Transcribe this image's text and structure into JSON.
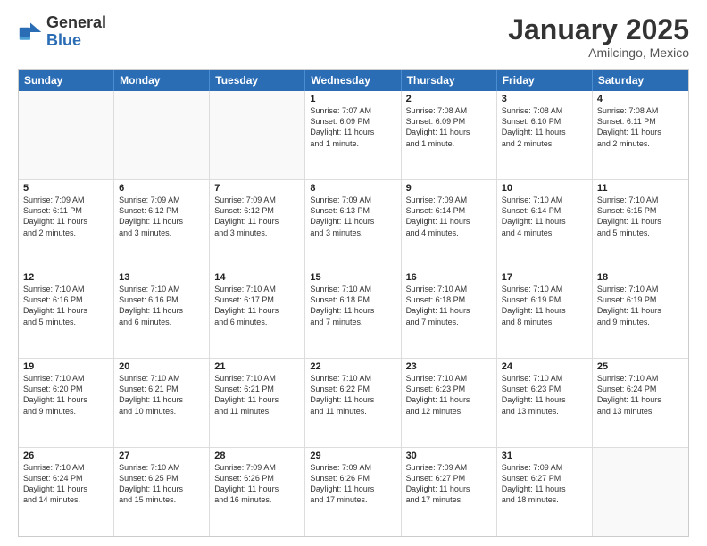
{
  "logo": {
    "general": "General",
    "blue": "Blue"
  },
  "title": "January 2025",
  "location": "Amilcingo, Mexico",
  "header_days": [
    "Sunday",
    "Monday",
    "Tuesday",
    "Wednesday",
    "Thursday",
    "Friday",
    "Saturday"
  ],
  "weeks": [
    [
      {
        "day": "",
        "text": "",
        "empty": true
      },
      {
        "day": "",
        "text": "",
        "empty": true
      },
      {
        "day": "",
        "text": "",
        "empty": true
      },
      {
        "day": "1",
        "text": "Sunrise: 7:07 AM\nSunset: 6:09 PM\nDaylight: 11 hours\nand 1 minute.",
        "empty": false
      },
      {
        "day": "2",
        "text": "Sunrise: 7:08 AM\nSunset: 6:09 PM\nDaylight: 11 hours\nand 1 minute.",
        "empty": false
      },
      {
        "day": "3",
        "text": "Sunrise: 7:08 AM\nSunset: 6:10 PM\nDaylight: 11 hours\nand 2 minutes.",
        "empty": false
      },
      {
        "day": "4",
        "text": "Sunrise: 7:08 AM\nSunset: 6:11 PM\nDaylight: 11 hours\nand 2 minutes.",
        "empty": false
      }
    ],
    [
      {
        "day": "5",
        "text": "Sunrise: 7:09 AM\nSunset: 6:11 PM\nDaylight: 11 hours\nand 2 minutes.",
        "empty": false
      },
      {
        "day": "6",
        "text": "Sunrise: 7:09 AM\nSunset: 6:12 PM\nDaylight: 11 hours\nand 3 minutes.",
        "empty": false
      },
      {
        "day": "7",
        "text": "Sunrise: 7:09 AM\nSunset: 6:12 PM\nDaylight: 11 hours\nand 3 minutes.",
        "empty": false
      },
      {
        "day": "8",
        "text": "Sunrise: 7:09 AM\nSunset: 6:13 PM\nDaylight: 11 hours\nand 3 minutes.",
        "empty": false
      },
      {
        "day": "9",
        "text": "Sunrise: 7:09 AM\nSunset: 6:14 PM\nDaylight: 11 hours\nand 4 minutes.",
        "empty": false
      },
      {
        "day": "10",
        "text": "Sunrise: 7:10 AM\nSunset: 6:14 PM\nDaylight: 11 hours\nand 4 minutes.",
        "empty": false
      },
      {
        "day": "11",
        "text": "Sunrise: 7:10 AM\nSunset: 6:15 PM\nDaylight: 11 hours\nand 5 minutes.",
        "empty": false
      }
    ],
    [
      {
        "day": "12",
        "text": "Sunrise: 7:10 AM\nSunset: 6:16 PM\nDaylight: 11 hours\nand 5 minutes.",
        "empty": false
      },
      {
        "day": "13",
        "text": "Sunrise: 7:10 AM\nSunset: 6:16 PM\nDaylight: 11 hours\nand 6 minutes.",
        "empty": false
      },
      {
        "day": "14",
        "text": "Sunrise: 7:10 AM\nSunset: 6:17 PM\nDaylight: 11 hours\nand 6 minutes.",
        "empty": false
      },
      {
        "day": "15",
        "text": "Sunrise: 7:10 AM\nSunset: 6:18 PM\nDaylight: 11 hours\nand 7 minutes.",
        "empty": false
      },
      {
        "day": "16",
        "text": "Sunrise: 7:10 AM\nSunset: 6:18 PM\nDaylight: 11 hours\nand 7 minutes.",
        "empty": false
      },
      {
        "day": "17",
        "text": "Sunrise: 7:10 AM\nSunset: 6:19 PM\nDaylight: 11 hours\nand 8 minutes.",
        "empty": false
      },
      {
        "day": "18",
        "text": "Sunrise: 7:10 AM\nSunset: 6:19 PM\nDaylight: 11 hours\nand 9 minutes.",
        "empty": false
      }
    ],
    [
      {
        "day": "19",
        "text": "Sunrise: 7:10 AM\nSunset: 6:20 PM\nDaylight: 11 hours\nand 9 minutes.",
        "empty": false
      },
      {
        "day": "20",
        "text": "Sunrise: 7:10 AM\nSunset: 6:21 PM\nDaylight: 11 hours\nand 10 minutes.",
        "empty": false
      },
      {
        "day": "21",
        "text": "Sunrise: 7:10 AM\nSunset: 6:21 PM\nDaylight: 11 hours\nand 11 minutes.",
        "empty": false
      },
      {
        "day": "22",
        "text": "Sunrise: 7:10 AM\nSunset: 6:22 PM\nDaylight: 11 hours\nand 11 minutes.",
        "empty": false
      },
      {
        "day": "23",
        "text": "Sunrise: 7:10 AM\nSunset: 6:23 PM\nDaylight: 11 hours\nand 12 minutes.",
        "empty": false
      },
      {
        "day": "24",
        "text": "Sunrise: 7:10 AM\nSunset: 6:23 PM\nDaylight: 11 hours\nand 13 minutes.",
        "empty": false
      },
      {
        "day": "25",
        "text": "Sunrise: 7:10 AM\nSunset: 6:24 PM\nDaylight: 11 hours\nand 13 minutes.",
        "empty": false
      }
    ],
    [
      {
        "day": "26",
        "text": "Sunrise: 7:10 AM\nSunset: 6:24 PM\nDaylight: 11 hours\nand 14 minutes.",
        "empty": false
      },
      {
        "day": "27",
        "text": "Sunrise: 7:10 AM\nSunset: 6:25 PM\nDaylight: 11 hours\nand 15 minutes.",
        "empty": false
      },
      {
        "day": "28",
        "text": "Sunrise: 7:09 AM\nSunset: 6:26 PM\nDaylight: 11 hours\nand 16 minutes.",
        "empty": false
      },
      {
        "day": "29",
        "text": "Sunrise: 7:09 AM\nSunset: 6:26 PM\nDaylight: 11 hours\nand 17 minutes.",
        "empty": false
      },
      {
        "day": "30",
        "text": "Sunrise: 7:09 AM\nSunset: 6:27 PM\nDaylight: 11 hours\nand 17 minutes.",
        "empty": false
      },
      {
        "day": "31",
        "text": "Sunrise: 7:09 AM\nSunset: 6:27 PM\nDaylight: 11 hours\nand 18 minutes.",
        "empty": false
      },
      {
        "day": "",
        "text": "",
        "empty": true
      }
    ]
  ]
}
